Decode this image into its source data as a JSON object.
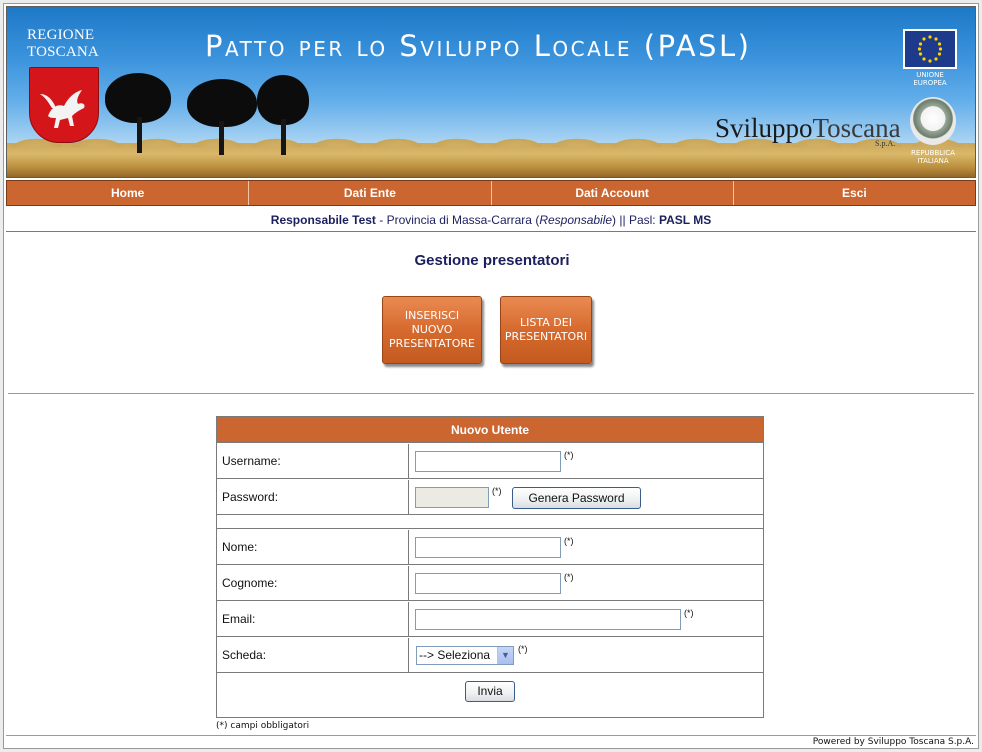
{
  "banner": {
    "regione_line1": "REGIONE",
    "regione_line2": "TOSCANA",
    "title": "Patto per lo Sviluppo Locale (PASL)",
    "eu_label_line1": "UNIONE",
    "eu_label_line2": "EUROPEA",
    "logo_part1": "Sviluppo",
    "logo_part2": "Toscana",
    "logo_spa": "S.p.A.",
    "repub_line1": "REPUBBLICA",
    "repub_line2": "ITALIANA"
  },
  "nav": {
    "items": [
      {
        "label": "Home"
      },
      {
        "label": "Dati Ente"
      },
      {
        "label": "Dati Account"
      },
      {
        "label": "Esci"
      }
    ]
  },
  "info": {
    "user": "Responsabile Test",
    "separator1": " - ",
    "ente": "Provincia di Massa-Carrara",
    "role": "Responsabile",
    "pasl_prefix": " || Pasl: ",
    "pasl": "PASL MS"
  },
  "main": {
    "title": "Gestione presentatori",
    "btn_inserisci": [
      "INSERISCI",
      "NUOVO",
      "PRESENTATORE"
    ],
    "btn_lista": [
      "LISTA DEI",
      "PRESENTATORI"
    ]
  },
  "form": {
    "header": "Nuovo Utente",
    "required_mark": "(*)",
    "fields": {
      "username": {
        "label": "Username:",
        "value": ""
      },
      "password": {
        "label": "Password:",
        "value": ""
      },
      "nome": {
        "label": "Nome:",
        "value": ""
      },
      "cognome": {
        "label": "Cognome:",
        "value": ""
      },
      "email": {
        "label": "Email:",
        "value": ""
      },
      "scheda": {
        "label": "Scheda:",
        "selected": "--> Seleziona"
      }
    },
    "generate_password_label": "Genera Password",
    "submit_label": "Invia",
    "footnote": "(*) campi obbligatori"
  },
  "footer": {
    "powered": "Powered by Sviluppo Toscana S.p.A."
  },
  "colors": {
    "accent": "#cb6630",
    "text_dark_blue": "#1b1f5e"
  }
}
